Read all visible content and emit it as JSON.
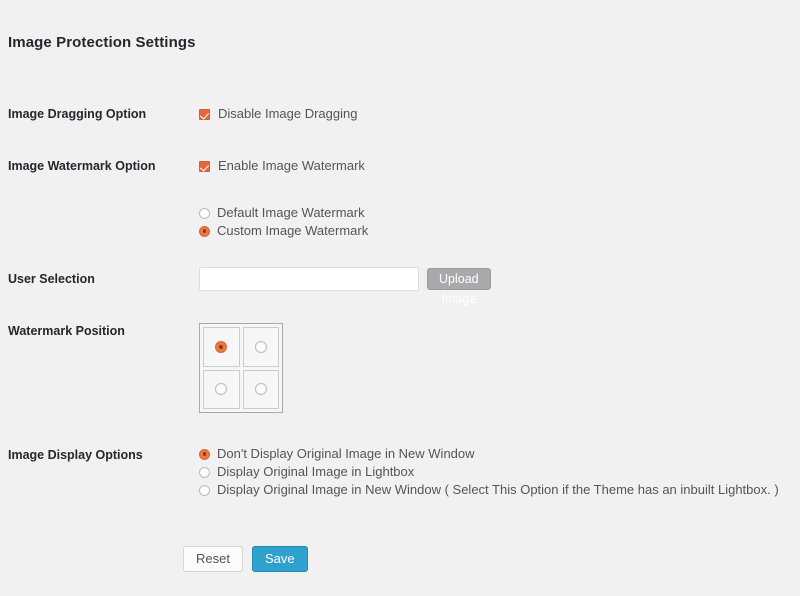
{
  "page": {
    "title": "Image Protection Settings",
    "accent_orange": "#e8673a",
    "accent_blue": "#2ea2cc",
    "background": "#f1f1f1"
  },
  "rows": {
    "dragging": {
      "label": "Image Dragging Option",
      "checkbox_label": "Disable Image Dragging",
      "checked": true
    },
    "watermark": {
      "label": "Image Watermark Option",
      "checkbox_label": "Enable Image Watermark",
      "checked": true,
      "options": [
        {
          "label": "Default Image Watermark",
          "selected": false
        },
        {
          "label": "Custom Image Watermark",
          "selected": true
        }
      ]
    },
    "user_selection": {
      "label": "User Selection",
      "input_value": "",
      "input_placeholder": "",
      "upload_button": "Upload Image"
    },
    "watermark_position": {
      "label": "Watermark Position",
      "cells": [
        {
          "position": "top-left",
          "selected": true
        },
        {
          "position": "top-right",
          "selected": false
        },
        {
          "position": "bottom-left",
          "selected": false
        },
        {
          "position": "bottom-right",
          "selected": false
        }
      ]
    },
    "display_options": {
      "label": "Image Display Options",
      "options": [
        {
          "label": "Don't Display Original Image in New Window",
          "selected": true
        },
        {
          "label": "Display Original Image in Lightbox",
          "selected": false
        },
        {
          "label": "Display Original Image in New Window ( Select This Option if the Theme has an inbuilt Lightbox. )",
          "selected": false
        }
      ]
    }
  },
  "buttons": {
    "reset": "Reset",
    "save": "Save"
  }
}
